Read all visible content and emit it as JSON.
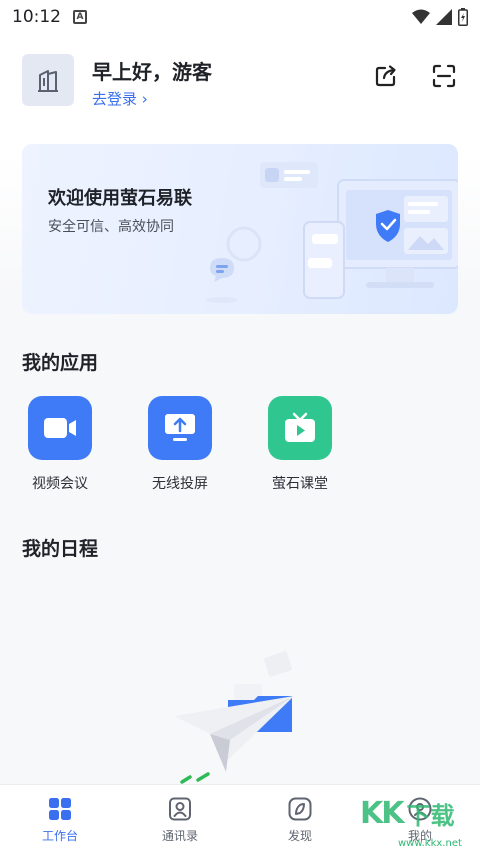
{
  "status_bar": {
    "time": "10:12",
    "notification_icon": "a-notification-icon",
    "icons": [
      "wifi-icon",
      "signal-icon",
      "battery-icon"
    ]
  },
  "header": {
    "greeting": "早上好，游客",
    "login_link": "去登录 ›",
    "avatar_icon": "building-icon",
    "actions": [
      "share-icon",
      "scan-icon"
    ]
  },
  "banner": {
    "title": "欢迎使用萤石易联",
    "subtitle": "安全可信、高效协同"
  },
  "my_apps": {
    "title": "我的应用",
    "items": [
      {
        "label": "视频会议",
        "icon": "video-camera-icon",
        "color": "#3f7bf6"
      },
      {
        "label": "无线投屏",
        "icon": "screen-cast-icon",
        "color": "#3f7bf6"
      },
      {
        "label": "萤石课堂",
        "icon": "tv-play-icon",
        "color": "#2fc690"
      }
    ]
  },
  "my_schedule": {
    "title": "我的日程"
  },
  "tabbar": {
    "items": [
      {
        "label": "工作台",
        "icon": "grid-icon",
        "active": true
      },
      {
        "label": "通讯录",
        "icon": "contacts-icon",
        "active": false
      },
      {
        "label": "发现",
        "icon": "compass-icon",
        "active": false
      },
      {
        "label": "我的",
        "icon": "user-icon",
        "active": false
      }
    ]
  },
  "watermark": {
    "brand": "KK",
    "text": "下载",
    "url": "www.kkx.net"
  },
  "colors": {
    "accent": "#3a6ff0",
    "app_blue": "#3f7bf6",
    "app_green": "#2fc690",
    "watermark": "#2eb872"
  }
}
